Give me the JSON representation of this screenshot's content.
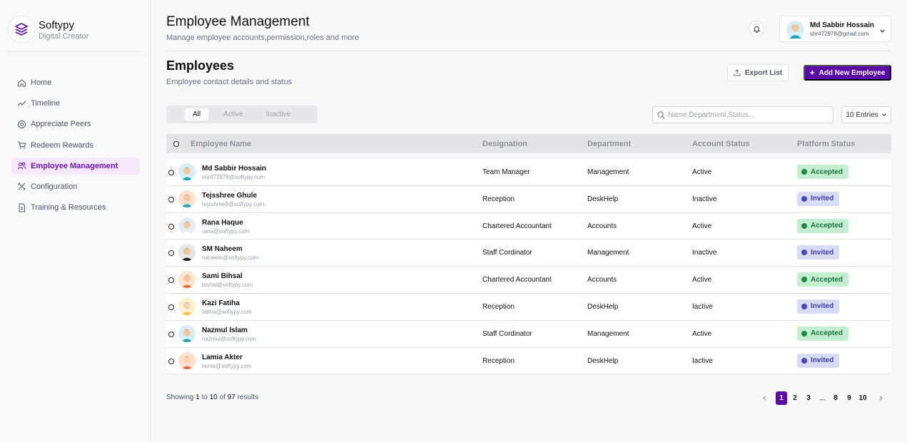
{
  "brand": {
    "name": "Softypy",
    "tagline": "Digital Creator"
  },
  "sidebar": {
    "items": [
      {
        "label": "Home",
        "icon": "home-icon"
      },
      {
        "label": "Timeline",
        "icon": "trend-icon"
      },
      {
        "label": "Appreciate Peers",
        "icon": "target-icon"
      },
      {
        "label": "Redeem Rewards",
        "icon": "cart-icon"
      },
      {
        "label": "Employee Management",
        "icon": "users-icon",
        "active": true
      },
      {
        "label": "Configuration",
        "icon": "tools-icon"
      },
      {
        "label": "Training & Resources",
        "icon": "document-icon"
      }
    ]
  },
  "header": {
    "title": "Employee Management",
    "subtitle": "Manage employee accounts,permission,roles and more",
    "user": {
      "name": "Md Sabbir Hossain",
      "email": "shr472978@gmail.com"
    }
  },
  "section": {
    "title": "Employees",
    "subtitle": "Employee contact details and status",
    "export_label": "Export List",
    "add_label": "Add New Employee"
  },
  "filters": {
    "tabs": [
      "All",
      "Active",
      "Inactive"
    ],
    "selected_tab": "All",
    "search_placeholder": "Name,Department,Status...",
    "entries_label": "10 Entries"
  },
  "table": {
    "headers": [
      "Employee Name",
      "Designation",
      "Department",
      "Account Status",
      "Platform Status"
    ],
    "rows": [
      {
        "name": "Md Sabbir Hossain",
        "email": "shr472978@softypy.com",
        "designation": "Team Manager",
        "department": "Management",
        "account": "Active",
        "platform": "Accepted"
      },
      {
        "name": "Tejsshree Ghule",
        "email": "tejsshree8@softypy.com",
        "designation": "Reception",
        "department": "DeskHelp",
        "account": "Inactive",
        "platform": "Invited"
      },
      {
        "name": "Rana Haque",
        "email": "rana@softypy.com",
        "designation": "Chartered Accountant",
        "department": "Accounts",
        "account": "Active",
        "platform": "Accepted"
      },
      {
        "name": "SM Naheem",
        "email": "naheem@softypy.com",
        "designation": "Staff Cordinator",
        "department": "Management",
        "account": "Inactive",
        "platform": "Invited"
      },
      {
        "name": "Sami Bihsal",
        "email": "bishal@softypy.com",
        "designation": "Chartered Accountant",
        "department": "Accounts",
        "account": "Active",
        "platform": "Accepted"
      },
      {
        "name": "Kazi Fatiha",
        "email": "fatiha@softypy.com",
        "designation": "Reception",
        "department": "DeskHelp",
        "account": "Iactive",
        "platform": "Invited"
      },
      {
        "name": "Nazmul Islam",
        "email": "nazmul@softypy.com",
        "designation": "Staff Cordinator",
        "department": "Management",
        "account": "Active",
        "platform": "Accepted"
      },
      {
        "name": "Lamia Akter",
        "email": "lamia@softypy.com",
        "designation": "Reception",
        "department": "DeskHelp",
        "account": "Iactive",
        "platform": "Invited"
      }
    ]
  },
  "footer": {
    "showing_prefix": "Showing",
    "from": "1",
    "to_word": "to",
    "to": "10",
    "of_word": "of",
    "total": "97",
    "results_word": "results"
  },
  "pagination": {
    "pages": [
      "1",
      "2",
      "3",
      "...",
      "8",
      "9",
      "10"
    ],
    "current": "1"
  },
  "colors": {
    "brand": "#5b0aa6",
    "accepted": "#c3efd0",
    "invited": "#d6dcf6",
    "active_nav": "#f6e9ff"
  }
}
